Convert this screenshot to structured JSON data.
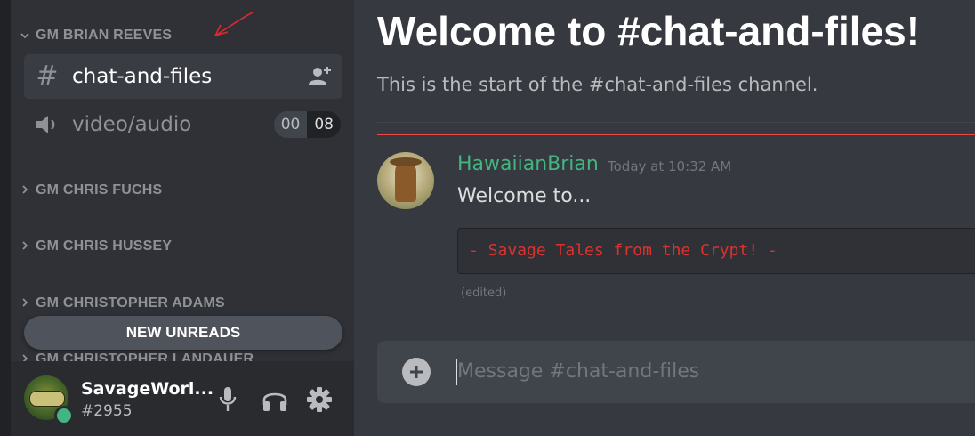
{
  "sidebar": {
    "categories": [
      {
        "name": "GM BRIAN REEVES",
        "expanded": true
      },
      {
        "name": "GM CHRIS FUCHS",
        "expanded": false
      },
      {
        "name": "GM CHRIS HUSSEY",
        "expanded": false
      },
      {
        "name": "GM CHRISTOPHER ADAMS",
        "expanded": false
      },
      {
        "name": "GM CHRISTOPHER LANDAUER",
        "expanded": false
      }
    ],
    "channels": [
      {
        "name": "chat-and-files",
        "type": "text",
        "selected": true,
        "icon": "hash-icon",
        "action_icon": "add-member-icon"
      },
      {
        "name": "video/audio",
        "type": "voice",
        "selected": false,
        "icon": "speaker-icon",
        "count_left": "00",
        "count_right": "08"
      }
    ],
    "new_unreads_label": "NEW UNREADS"
  },
  "user_panel": {
    "username": "SavageWorl...",
    "discriminator": "#2955",
    "status": "online",
    "status_color": "#43b581",
    "buttons": [
      "microphone-icon",
      "headphones-icon",
      "gear-icon"
    ]
  },
  "main": {
    "welcome_title": "Welcome to #chat-and-files!",
    "welcome_subtitle": "This is the start of the #chat-and-files channel.",
    "messages": [
      {
        "author": "HawaiianBrian",
        "author_color": "#43b581",
        "timestamp": "Today at 10:32 AM",
        "text": "Welcome to...",
        "code": "- Savage Tales from the Crypt! -",
        "edited_label": "(edited)"
      }
    ],
    "composer": {
      "placeholder": "Message #chat-and-files",
      "value": ""
    }
  },
  "theme": {
    "background": "#36393f",
    "sidebar": "#2f3136",
    "accent_green": "#43b581",
    "new_messages_divider": "#f04747",
    "code_text": "#dc322f"
  }
}
